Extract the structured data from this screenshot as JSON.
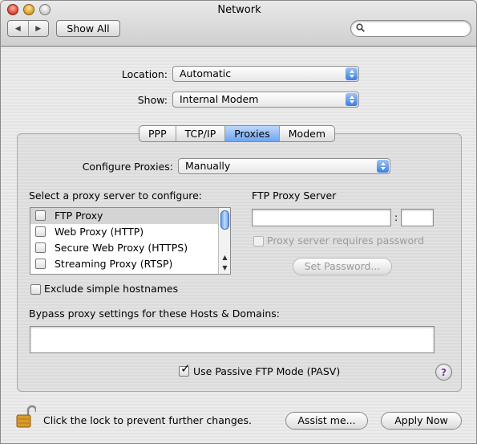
{
  "window": {
    "title": "Network"
  },
  "toolbar": {
    "back_label": "◀",
    "forward_label": "▶",
    "show_all_label": "Show All",
    "search_placeholder": ""
  },
  "location": {
    "label": "Location:",
    "value": "Automatic"
  },
  "show": {
    "label": "Show:",
    "value": "Internal Modem"
  },
  "tabs": [
    {
      "label": "PPP",
      "active": false
    },
    {
      "label": "TCP/IP",
      "active": false
    },
    {
      "label": "Proxies",
      "active": true
    },
    {
      "label": "Modem",
      "active": false
    }
  ],
  "configure": {
    "label": "Configure Proxies:",
    "value": "Manually"
  },
  "proxy_list": {
    "heading": "Select a proxy server to configure:",
    "items": [
      {
        "label": "FTP Proxy",
        "checked": false,
        "selected": true
      },
      {
        "label": "Web Proxy (HTTP)",
        "checked": false,
        "selected": false
      },
      {
        "label": "Secure Web Proxy (HTTPS)",
        "checked": false,
        "selected": false
      },
      {
        "label": "Streaming Proxy (RTSP)",
        "checked": false,
        "selected": false
      }
    ]
  },
  "server": {
    "heading": "FTP Proxy Server",
    "host_value": "",
    "separator": ":",
    "port_value": "",
    "password_checkbox_label": "Proxy server requires password",
    "set_password_label": "Set Password..."
  },
  "exclude": {
    "label": "Exclude simple hostnames",
    "checked": false
  },
  "bypass": {
    "label": "Bypass proxy settings for these Hosts & Domains:",
    "value": ""
  },
  "passive": {
    "label": "Use Passive FTP Mode (PASV)",
    "checked": true
  },
  "help": {
    "label": "?"
  },
  "footer": {
    "lock_text": "Click the lock to prevent further changes.",
    "assist_label": "Assist me...",
    "apply_label": "Apply Now"
  },
  "colors": {
    "accent": "#3d7fe0",
    "help_glyph": "#6b3fa0",
    "lock": "#d79a2b"
  }
}
